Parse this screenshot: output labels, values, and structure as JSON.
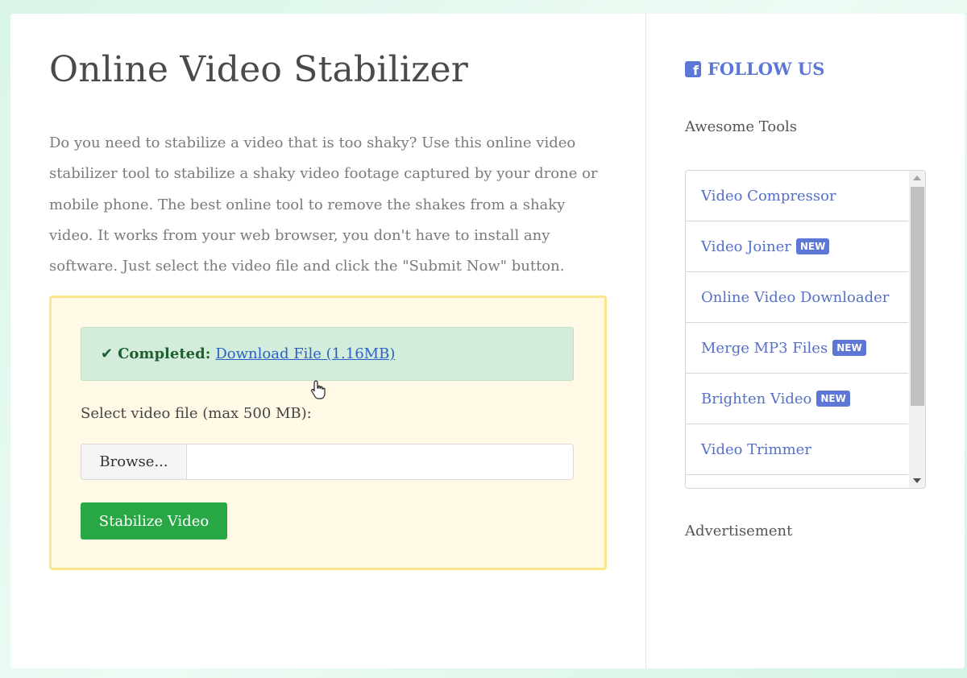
{
  "page": {
    "title": "Online Video Stabilizer",
    "intro": "Do you need to stabilize a video that is too shaky? Use this online video stabilizer tool to stabilize a shaky video footage captured by your drone or mobile phone. The best online tool to remove the shakes from a shaky video. It works from your web browser, you don't have to install any software. Just select the video file and click the \"Submit Now\" button."
  },
  "alert": {
    "status": "Completed:",
    "link_text": "Download File (1.16MB)"
  },
  "form": {
    "label": "Select video file (max 500 MB):",
    "browse_label": "Browse...",
    "submit_label": "Stabilize Video"
  },
  "sidebar": {
    "follow_label": "FOLLOW US",
    "tools_title": "Awesome Tools",
    "tools": [
      {
        "label": "Video Compressor",
        "badge": ""
      },
      {
        "label": "Video Joiner",
        "badge": "NEW"
      },
      {
        "label": "Online Video Downloader",
        "badge": ""
      },
      {
        "label": "Merge MP3 Files",
        "badge": "NEW"
      },
      {
        "label": "Brighten Video",
        "badge": "NEW"
      },
      {
        "label": "Video Trimmer",
        "badge": ""
      }
    ],
    "ad_label": "Advertisement"
  },
  "colors": {
    "accent": "#5d77d6",
    "success": "#28a745",
    "panel_bg": "#fff9e5",
    "panel_border": "#fbe68a"
  }
}
